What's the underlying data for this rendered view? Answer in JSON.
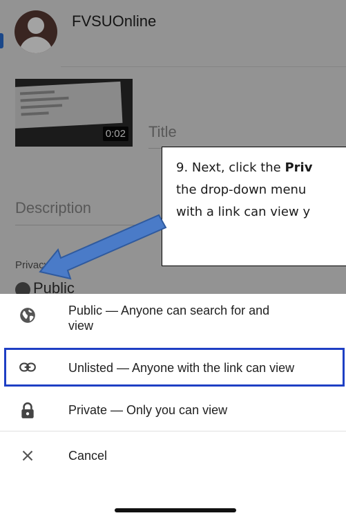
{
  "header": {
    "channel_name": "FVSUOnline"
  },
  "video": {
    "duration": "0:02"
  },
  "form": {
    "title_placeholder": "Title",
    "description_placeholder": "Description",
    "privacy_label": "Privacy",
    "privacy_value": "Public"
  },
  "callout": {
    "line1_prefix": "9. Next, click the ",
    "line1_bold": "Priv",
    "line2": "the drop-down menu",
    "line3": "with a link can view y"
  },
  "privacy_sheet": {
    "options": [
      {
        "label": "Public — Anyone can search for and view",
        "icon": "globe-icon"
      },
      {
        "label": "Unlisted — Anyone with the link can view",
        "icon": "link-icon"
      },
      {
        "label": "Private — Only you can view",
        "icon": "lock-icon"
      }
    ],
    "cancel_label": "Cancel",
    "highlight_color": "#1e3fc4"
  },
  "colors": {
    "accent": "#2a6fd6",
    "arrow_fill": "#4a7bc8"
  }
}
